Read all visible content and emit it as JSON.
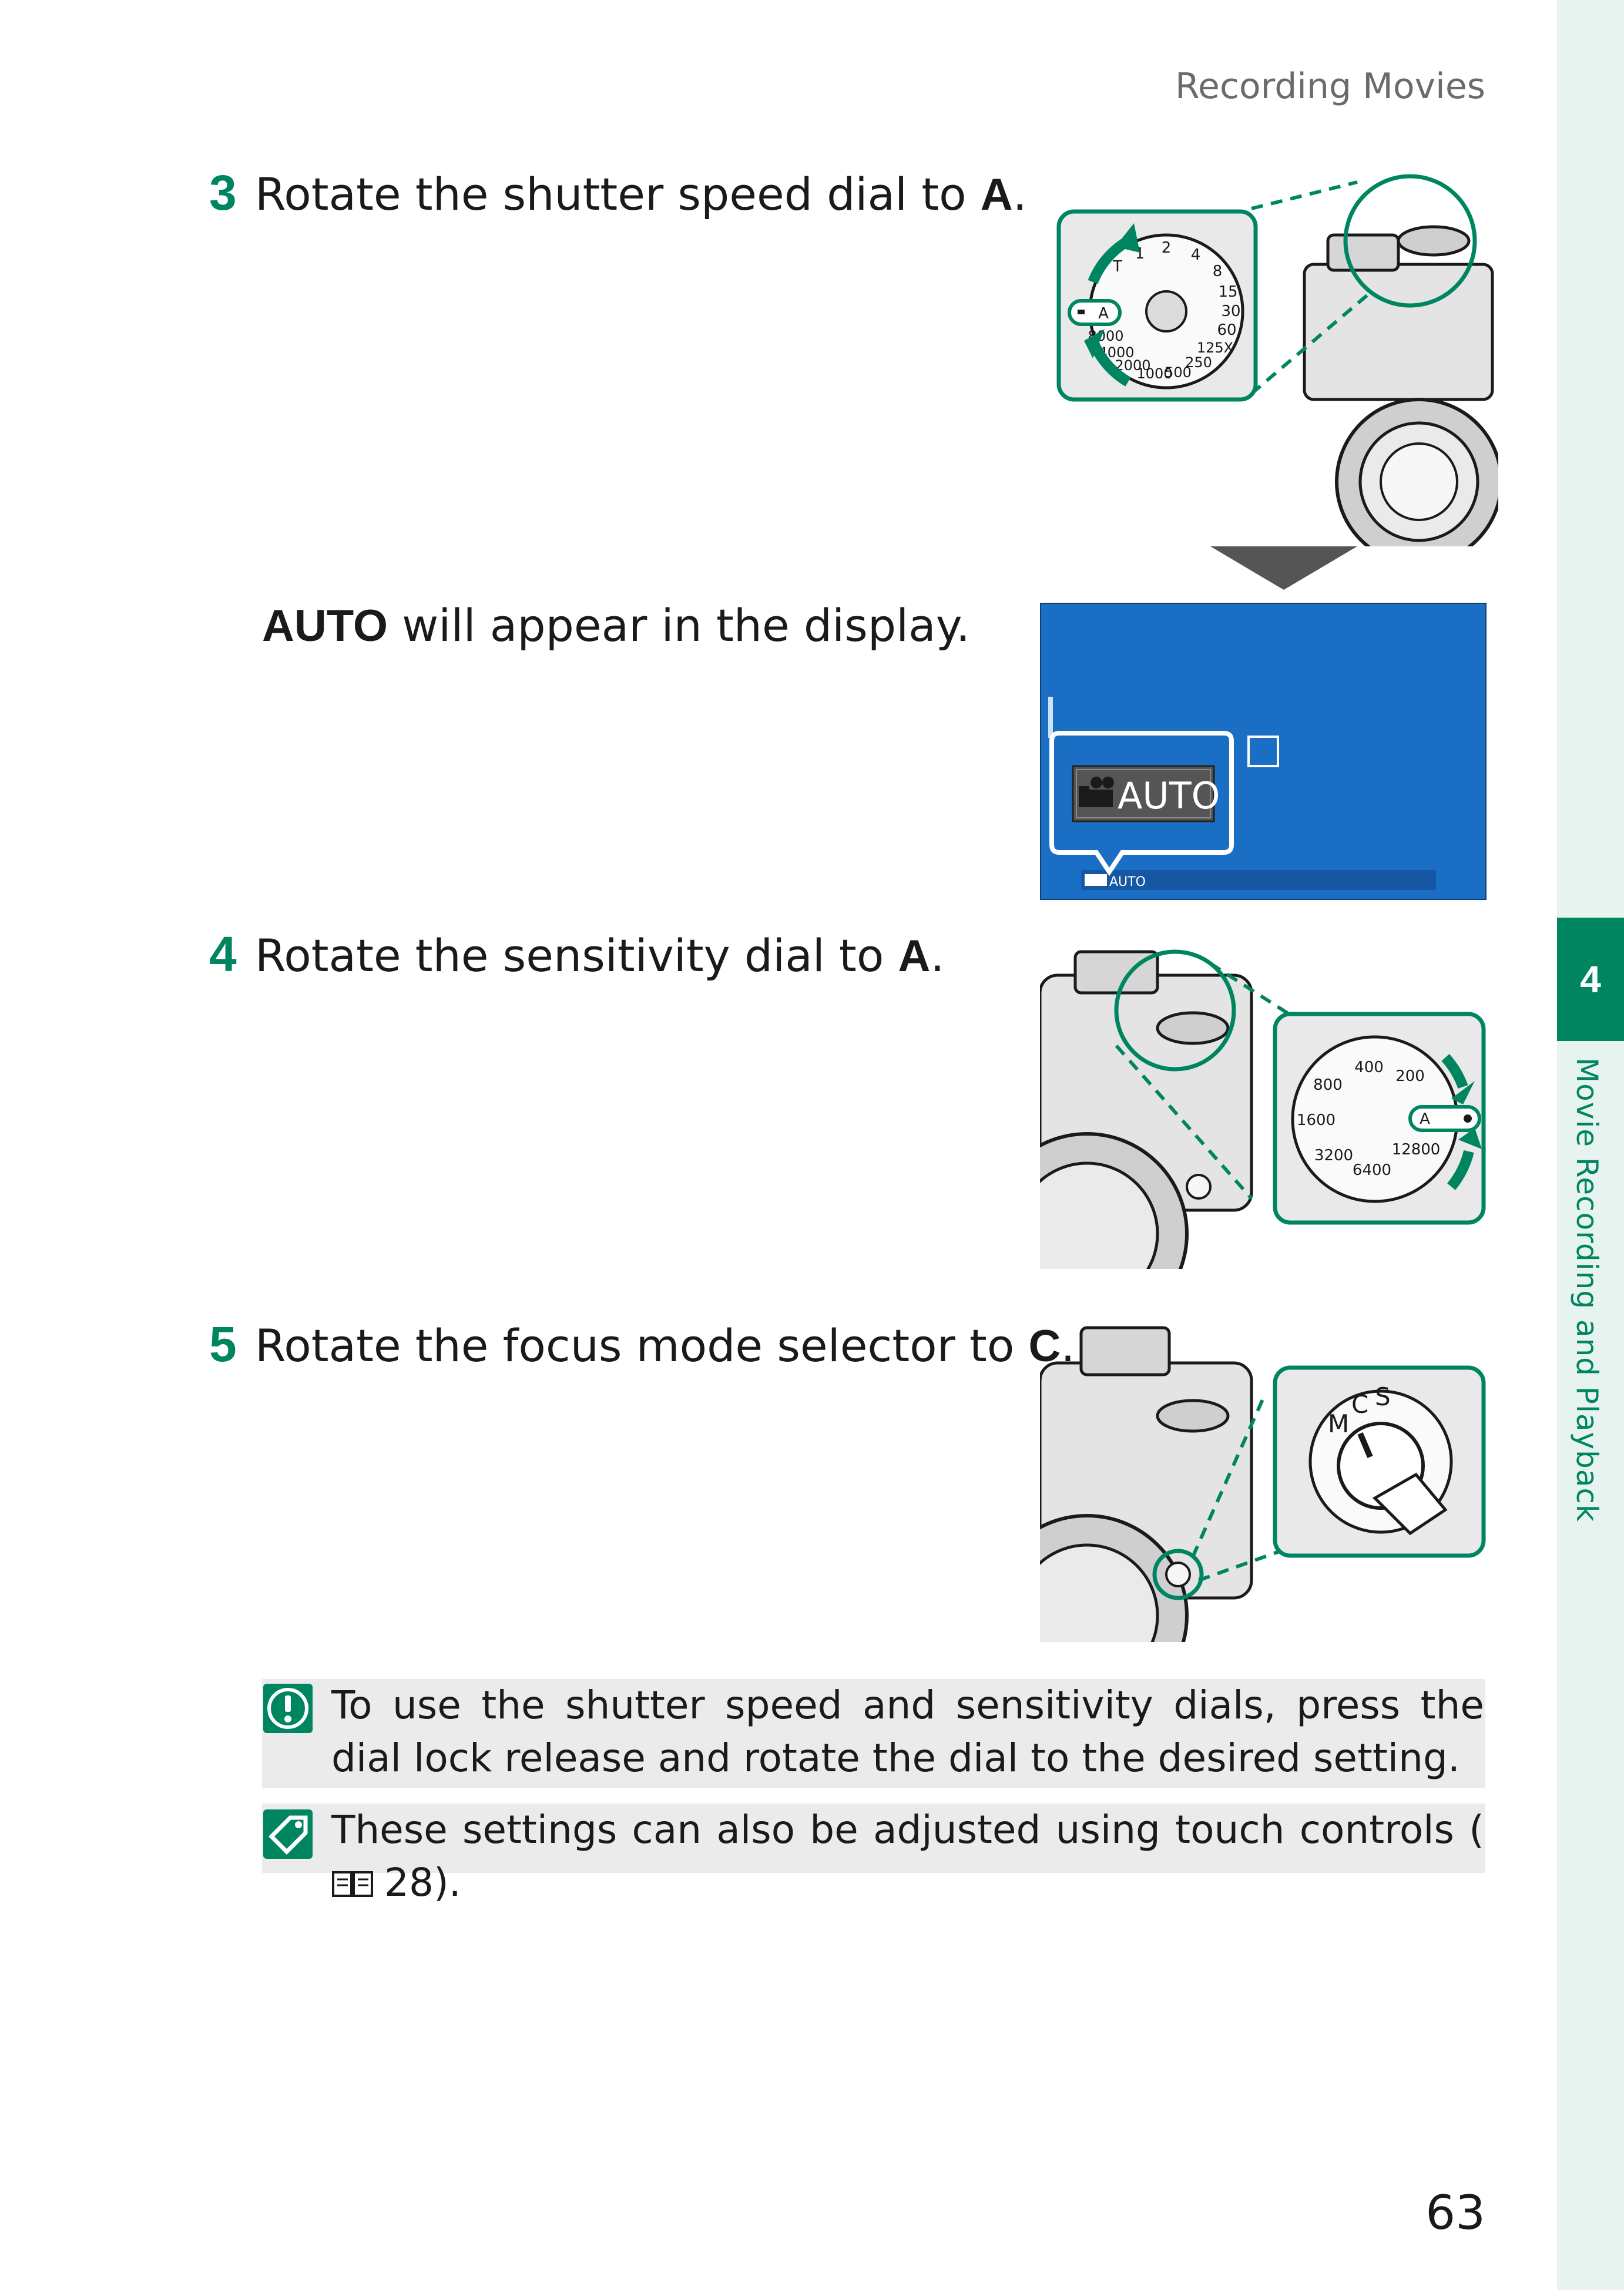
{
  "header": {
    "running_title": "Recording Movies"
  },
  "side": {
    "chapter_number": "4",
    "chapter_title": "Movie Recording and Playback"
  },
  "steps": [
    {
      "number": "3",
      "text": "Rotate the shutter speed dial to ",
      "target": "A",
      "end": "."
    },
    {
      "number": "4",
      "text": "Rotate the sensitivity dial to ",
      "target": "A",
      "end": "."
    },
    {
      "number": "5",
      "text": "Rotate the focus mode selector to ",
      "target": "C",
      "end": "."
    }
  ],
  "auto_line": {
    "bold": "AUTO",
    "rest": " will appear in the display."
  },
  "illustrations": {
    "shutter_dial_labels": [
      "2",
      "4",
      "8",
      "15",
      "30",
      "60",
      "125X",
      "250",
      "500",
      "1000",
      "2000",
      "4000",
      "8000",
      "1",
      "T",
      "A"
    ],
    "display_badge": "AUTO",
    "display_bottom": "AUTO",
    "iso_dial_labels": [
      "200",
      "400",
      "800",
      "1600",
      "3200",
      "6400",
      "12800",
      "A"
    ],
    "focus_selector_labels": [
      "M",
      "C",
      "S"
    ]
  },
  "notes": [
    {
      "icon": "caution-icon",
      "text": "To use the shutter speed and sensitivity dials, press the dial lock release and rotate the dial to the desired setting."
    },
    {
      "icon": "tip-icon",
      "text": "These settings can also be adjusted using touch controls (",
      "page_ref": "28",
      "end": ")."
    }
  ],
  "footer": {
    "page_number": "63"
  },
  "colors": {
    "accent": "#008561",
    "lcd_blue": "#1a6fc4",
    "note_bg": "#ebebeb",
    "side_strip": "#e6f3ee"
  }
}
